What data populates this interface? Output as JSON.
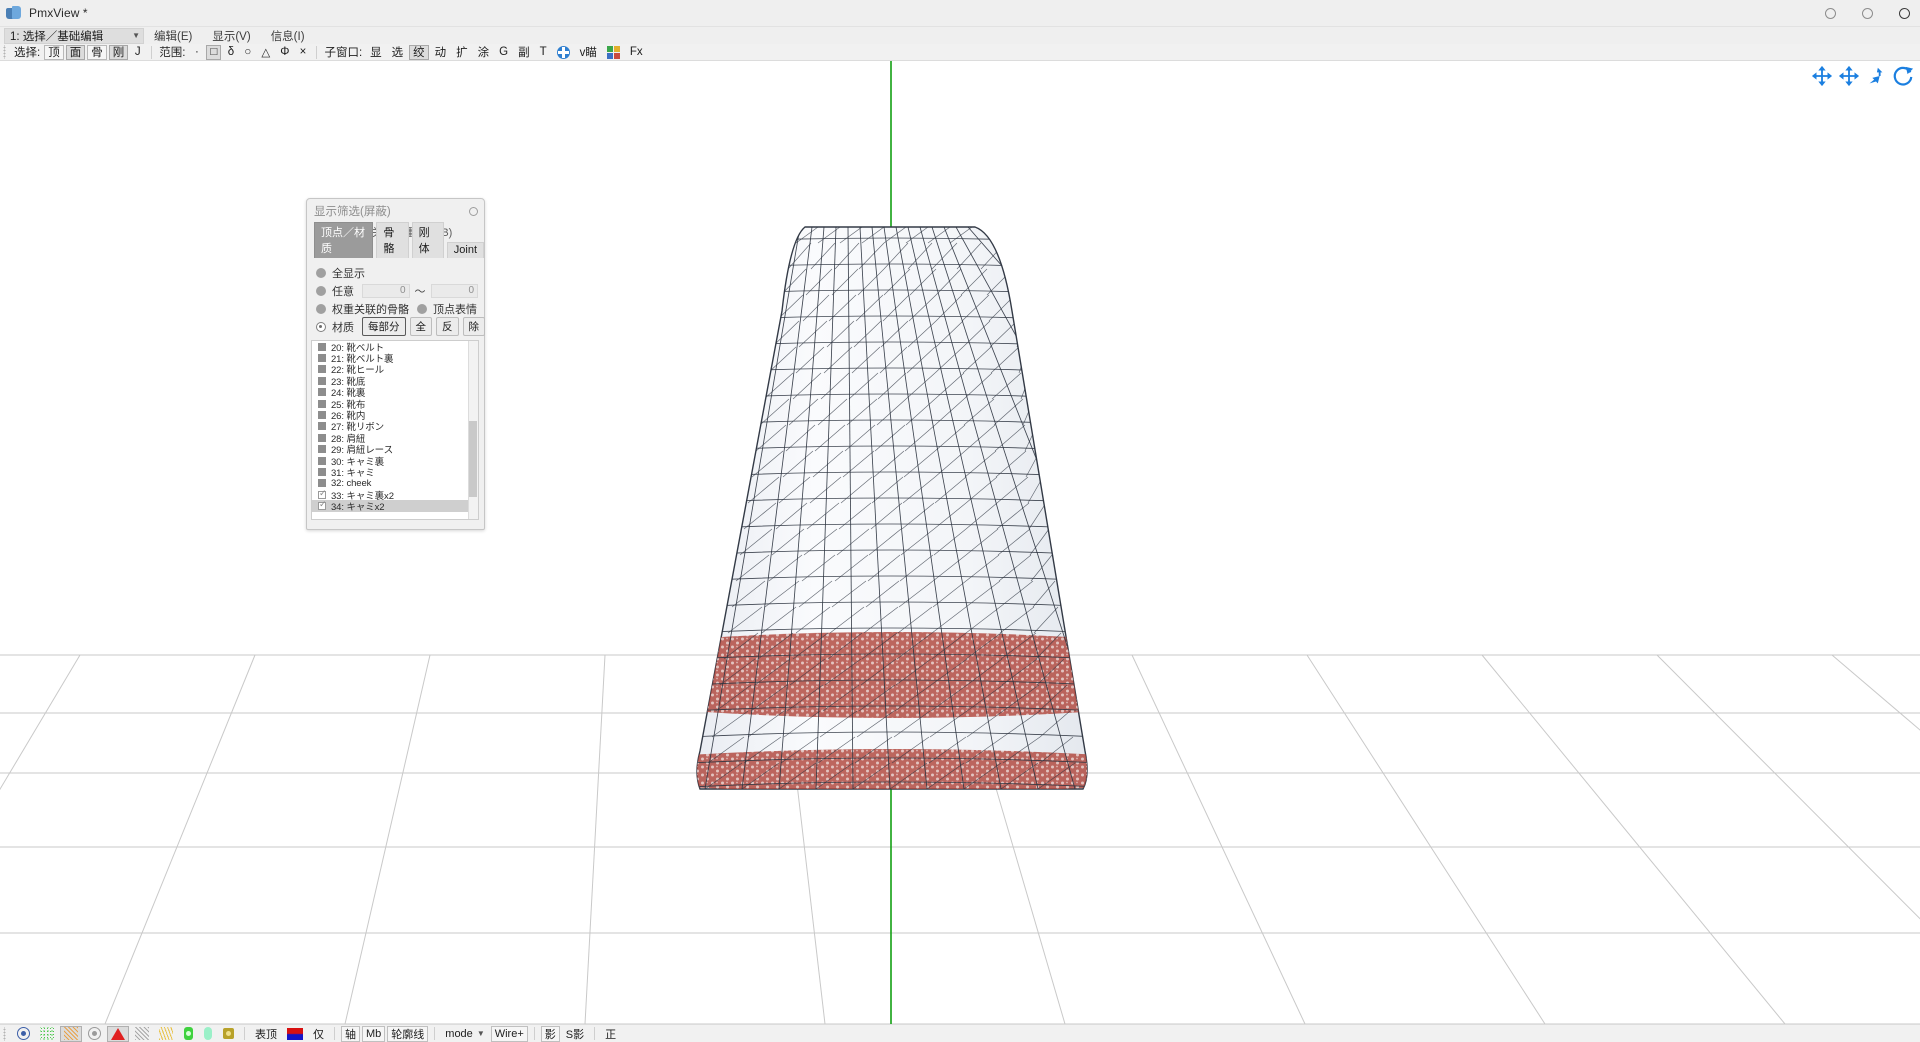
{
  "window": {
    "title": "PmxView *",
    "app_icon": "pmx-logo-icon",
    "controls": [
      "minimize",
      "maximize",
      "close"
    ]
  },
  "menu": {
    "mode_selector": "1: 选择／基础编辑",
    "items": [
      {
        "label": "编辑(E)",
        "name": "menu-edit"
      },
      {
        "label": "显示(V)",
        "name": "menu-view"
      },
      {
        "label": "信息(I)",
        "name": "menu-info"
      }
    ]
  },
  "toolbar": {
    "select_label": "选择:",
    "select_buttons": [
      {
        "label": "顶",
        "active": false
      },
      {
        "label": "面",
        "active": true
      },
      {
        "label": "骨",
        "active": false
      },
      {
        "label": "刚",
        "active": true
      }
    ],
    "j_button": "J",
    "range_label": "范围:",
    "range_buttons": [
      {
        "label": "·",
        "active": false
      },
      {
        "label": "□",
        "active": true
      },
      {
        "label": "δ",
        "active": false
      },
      {
        "label": "○",
        "active": false
      },
      {
        "label": "△",
        "active": false
      },
      {
        "label": "Φ",
        "active": false
      },
      {
        "label": "×",
        "active": false
      }
    ],
    "subwindow_label": "子窗口:",
    "subwindow_buttons": [
      {
        "label": "显",
        "active": false
      },
      {
        "label": "选",
        "active": false
      },
      {
        "label": "绞",
        "active": true
      },
      {
        "label": "动",
        "active": false
      },
      {
        "label": "扩",
        "active": false
      },
      {
        "label": "涂",
        "active": false
      },
      {
        "label": "G",
        "active": false
      },
      {
        "label": "副",
        "active": false
      },
      {
        "label": "T",
        "active": false
      }
    ],
    "axis_icon": "axis-cross-icon",
    "vcam_label": "v瞄",
    "grid_icon": "color-grid-icon",
    "fx_label": "Fx"
  },
  "viewport": {
    "gizmos": [
      {
        "name": "move-gizmo-icon",
        "glyph": "move"
      },
      {
        "name": "pan-gizmo-icon",
        "glyph": "pan"
      },
      {
        "name": "zoom-gizmo-icon",
        "glyph": "zoom"
      },
      {
        "name": "rotate-gizmo-icon",
        "glyph": "rotate"
      }
    ],
    "model": {
      "description": "skirt-wireframe-mesh",
      "mesh_line_color": "#2a2f3a",
      "surface_color": "#f4f6f9",
      "lace_band_color": "#b04a42",
      "axis_line_color": "#13a013",
      "grid_color": "#c8c8c8"
    }
  },
  "filter_dialog": {
    "title": "显示筛选(屏蔽)",
    "close_icon": "close-circle-icon",
    "menus": [
      {
        "label": "编辑(E)",
        "name": "dialog-menu-edit"
      },
      {
        "label": "关于权重骨骼(B)",
        "name": "dialog-menu-weight-bone"
      }
    ],
    "tabs": [
      {
        "label": "顶点／材质",
        "active": true
      },
      {
        "label": "骨骼",
        "active": false
      },
      {
        "label": "刚体",
        "active": false
      },
      {
        "label": "Joint",
        "active": false
      }
    ],
    "options": [
      {
        "label": "全显示",
        "selected": false,
        "name": "option-show-all"
      },
      {
        "label": "任意",
        "selected": false,
        "name": "option-any"
      },
      {
        "label": "权重关联的骨骼",
        "selected": false,
        "name": "option-weight-bone"
      },
      {
        "label": "顶点表情",
        "selected": false,
        "name": "option-vertex-morph"
      },
      {
        "label": "材质",
        "selected": true,
        "name": "option-material"
      }
    ],
    "range_from": "0",
    "range_to": "0",
    "tilde": "～",
    "material_buttons": [
      {
        "label": "每部分",
        "strong": true,
        "name": "btn-each-part"
      },
      {
        "label": "全",
        "strong": false,
        "name": "btn-all"
      },
      {
        "label": "反",
        "strong": false,
        "name": "btn-invert"
      },
      {
        "label": "除",
        "strong": false,
        "name": "btn-clear"
      }
    ],
    "material_list": [
      {
        "label": "20: 靴ベルト",
        "checked": false,
        "selected": false
      },
      {
        "label": "21: 靴ベルト裏",
        "checked": false,
        "selected": false
      },
      {
        "label": "22: 靴ヒール",
        "checked": false,
        "selected": false
      },
      {
        "label": "23: 靴底",
        "checked": false,
        "selected": false
      },
      {
        "label": "24: 靴裏",
        "checked": false,
        "selected": false
      },
      {
        "label": "25: 靴布",
        "checked": false,
        "selected": false
      },
      {
        "label": "26: 靴内",
        "checked": false,
        "selected": false
      },
      {
        "label": "27: 靴リボン",
        "checked": false,
        "selected": false
      },
      {
        "label": "28: 肩紐",
        "checked": false,
        "selected": false
      },
      {
        "label": "29: 肩紐レース",
        "checked": false,
        "selected": false
      },
      {
        "label": "30: キャミ裏",
        "checked": false,
        "selected": false
      },
      {
        "label": "31: キャミ",
        "checked": false,
        "selected": false
      },
      {
        "label": "32: cheek",
        "checked": false,
        "selected": false
      },
      {
        "label": "33: キャミ裏x2",
        "checked": true,
        "selected": false
      },
      {
        "label": "34: キャミx2",
        "checked": true,
        "selected": true
      }
    ]
  },
  "bottombar": {
    "icon_buttons": [
      {
        "name": "vertex-point-icon",
        "active": false
      },
      {
        "name": "vertex-cloud-icon",
        "active": false
      },
      {
        "name": "face-hatch-icon",
        "active": true
      },
      {
        "name": "point-gray-icon",
        "active": false
      },
      {
        "name": "face-triangle-icon",
        "active": true
      },
      {
        "name": "edge-gray-icon",
        "active": false
      },
      {
        "name": "edge-yellow-icon",
        "active": false
      },
      {
        "name": "bone-icon",
        "active": false
      },
      {
        "name": "rigidbody-icon",
        "active": false
      },
      {
        "name": "joint-icon",
        "active": false
      }
    ],
    "surface_vertex_label": "表顶",
    "color_swatch": "red-blue-swatch",
    "only_label": "仅",
    "axis_label": "轴",
    "mb_label": "Mb",
    "outline_label": "轮廓线",
    "mode_label": "mode",
    "wire_label": "Wire+",
    "shadow_label": "影",
    "self_shadow_label": "S影",
    "front_label": "正"
  }
}
